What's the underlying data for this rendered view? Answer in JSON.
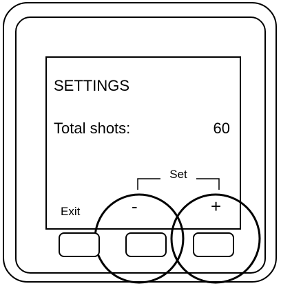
{
  "screen": {
    "title": "SETTINGS",
    "setting_label": "Total shots:",
    "setting_value": "60"
  },
  "softkeys": {
    "exit_label": "Exit",
    "minus_label": "-",
    "plus_label": "+",
    "group_label": "Set"
  },
  "colors": {
    "outline": "#000000",
    "background": "#ffffff"
  }
}
